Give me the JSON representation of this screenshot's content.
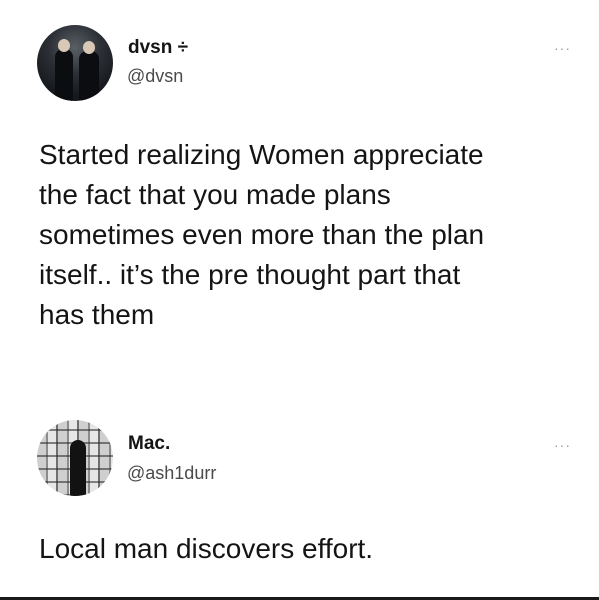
{
  "tweets": [
    {
      "avatar_icon": "profile-photo-two-men",
      "display_name": "dvsn ÷",
      "handle": "@dvsn",
      "more_label": "···",
      "text_lines": [
        "Started realizing Women appreciate",
        "the fact that you made plans",
        "sometimes even more than the plan",
        "itself.. it’s the pre thought part that",
        "has them"
      ]
    },
    {
      "avatar_icon": "profile-photo-man-at-wall",
      "display_name": "Mac.",
      "handle": "@ash1durr",
      "more_label": "···",
      "text_lines": [
        "Local man discovers effort."
      ]
    }
  ]
}
